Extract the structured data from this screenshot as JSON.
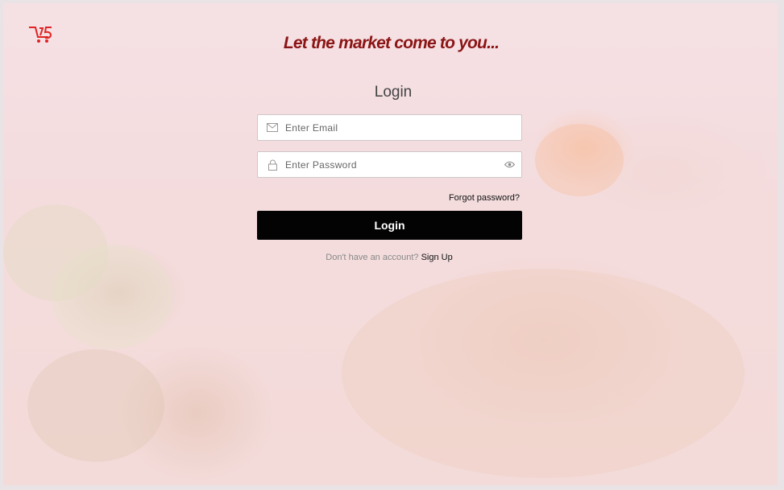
{
  "brand": {
    "accent": "#e02424",
    "tagline_color": "#8b1414",
    "logo_icon": "shopping-cart-logo-icon"
  },
  "header": {
    "tagline": "Let the market come to you..."
  },
  "form": {
    "title": "Login",
    "email": {
      "placeholder": "Enter Email",
      "icon": "envelope-icon"
    },
    "password": {
      "placeholder": "Enter Password",
      "icon": "lock-icon",
      "toggle_icon": "eye-icon"
    },
    "forgot_password": "Forgot password?",
    "submit_label": "Login",
    "signup_prompt": "Don't have an account?",
    "signup_link": "Sign Up"
  }
}
